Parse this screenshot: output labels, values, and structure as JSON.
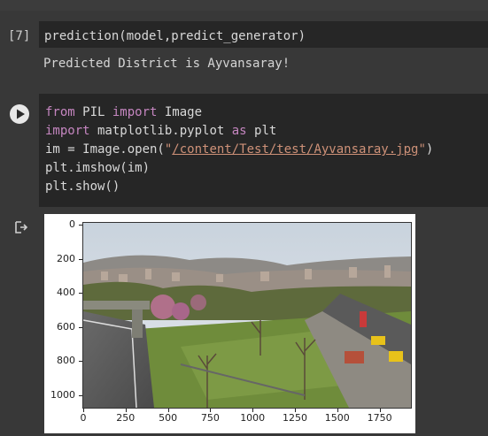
{
  "cell1": {
    "exec_count": "[7]",
    "code": "prediction(model,predict_generator)",
    "output": "Predicted District is Ayvansaray!"
  },
  "cell2": {
    "code_lines": [
      [
        {
          "t": "from",
          "c": "kw"
        },
        {
          "t": " PIL ",
          "c": "pl"
        },
        {
          "t": "import",
          "c": "kw"
        },
        {
          "t": " Image",
          "c": "pl"
        }
      ],
      [
        {
          "t": "import",
          "c": "kw"
        },
        {
          "t": " matplotlib.pyplot ",
          "c": "pl"
        },
        {
          "t": "as",
          "c": "kw"
        },
        {
          "t": " plt",
          "c": "pl"
        }
      ],
      [
        {
          "t": "im = Image.open(",
          "c": "pl"
        },
        {
          "t": "\"",
          "c": "str"
        },
        {
          "t": "/content/Test/test/Ayvansaray.jpg",
          "c": "strlink"
        },
        {
          "t": "\"",
          "c": "str"
        },
        {
          "t": ")",
          "c": "pl"
        }
      ],
      [
        {
          "t": "plt.imshow(im)",
          "c": "pl"
        }
      ],
      [
        {
          "t": "plt.show()",
          "c": "pl"
        }
      ]
    ]
  },
  "plot": {
    "y_ticks": [
      "0",
      "200",
      "400",
      "600",
      "800",
      "1000"
    ],
    "x_ticks": [
      "0",
      "250",
      "500",
      "750",
      "1000",
      "1250",
      "1500",
      "1750"
    ],
    "image_description_icon": "photo-ayvansaray"
  },
  "colors": {
    "keyword": "#c586c0",
    "string": "#ce9178",
    "code_bg": "#262626",
    "cell_bg": "#383838"
  }
}
